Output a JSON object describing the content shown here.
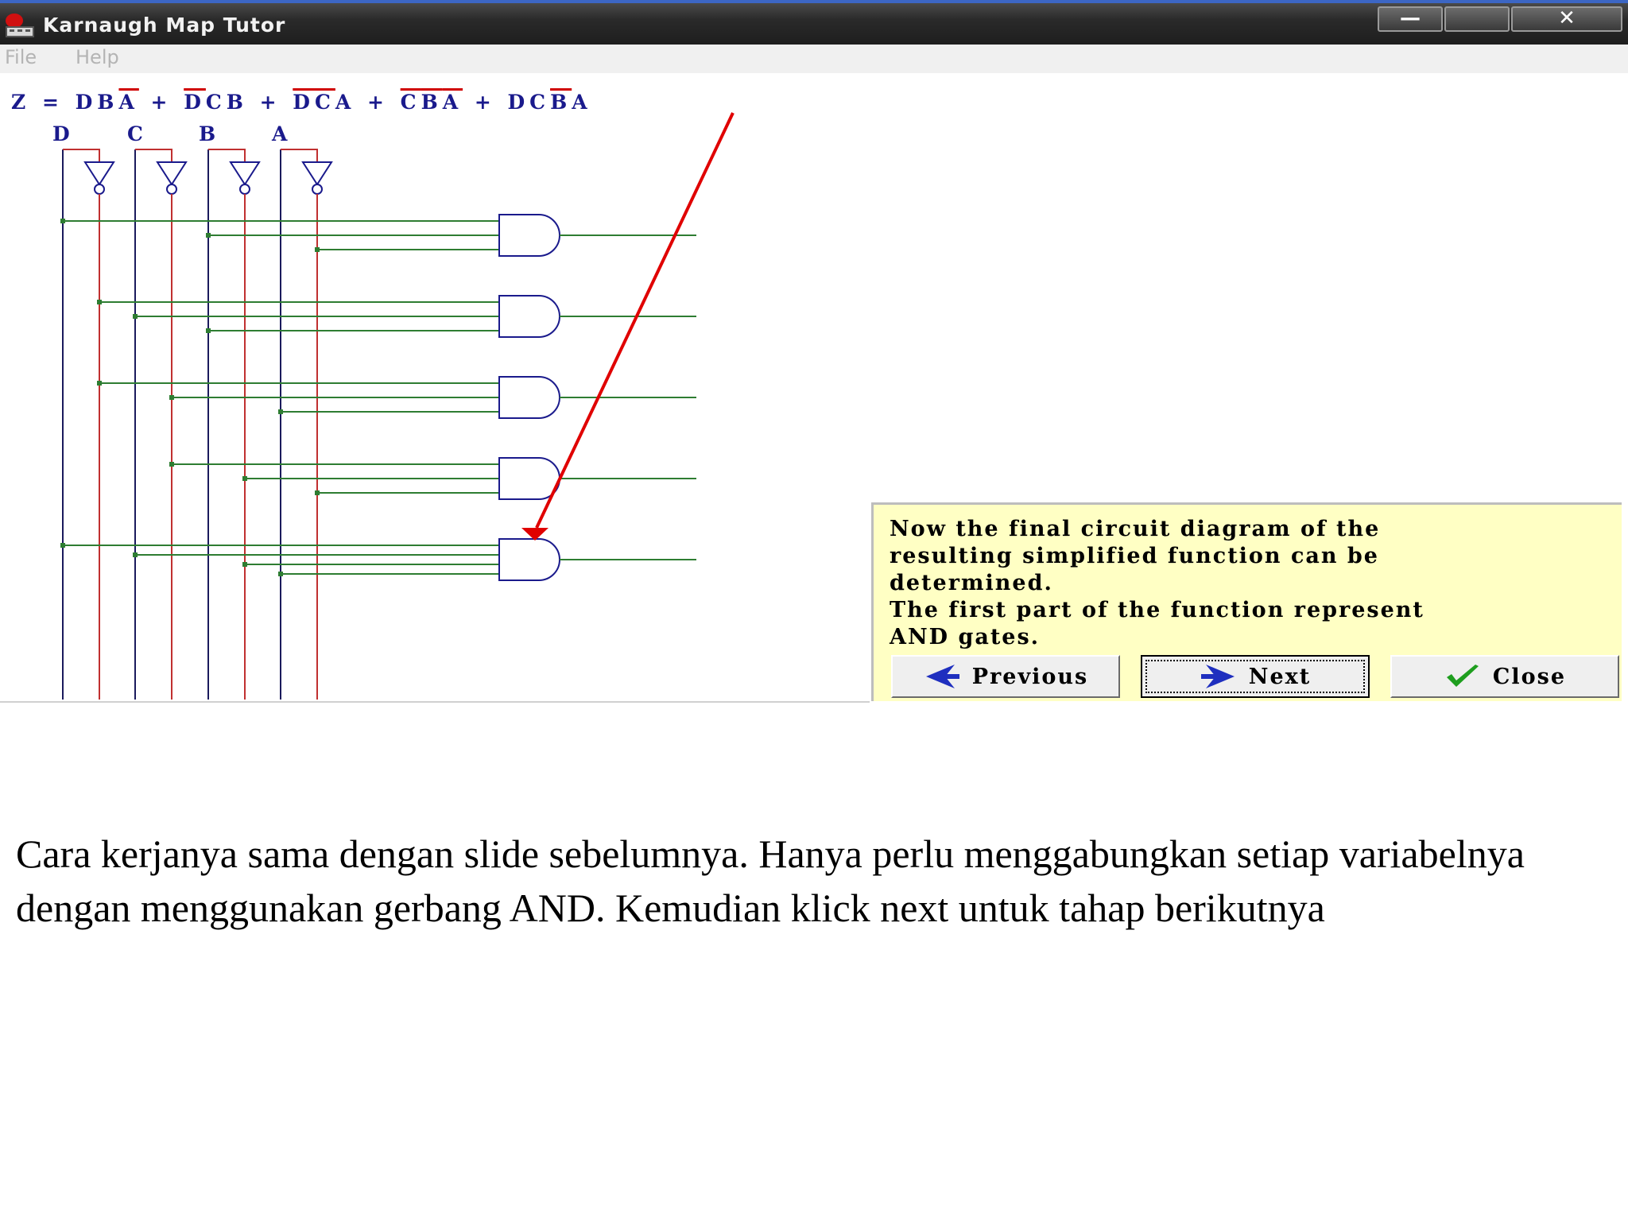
{
  "window": {
    "title": "Karnaugh Map Tutor",
    "minimize_symbol": "—",
    "maximize_symbol": "",
    "close_symbol": "✕"
  },
  "menu": {
    "items": [
      "File",
      "Help"
    ]
  },
  "circuit": {
    "equation_prefix": "Z = ",
    "terms": [
      {
        "parts": [
          {
            "v": "D",
            "neg": false
          },
          {
            "v": "B",
            "neg": false
          },
          {
            "v": "A",
            "neg": true
          }
        ]
      },
      {
        "parts": [
          {
            "v": "D",
            "neg": true
          },
          {
            "v": "C",
            "neg": false
          },
          {
            "v": "B",
            "neg": false
          }
        ]
      },
      {
        "parts": [
          {
            "v": "D",
            "neg": true
          },
          {
            "v": "C",
            "neg": true
          },
          {
            "v": "A",
            "neg": false
          }
        ]
      },
      {
        "parts": [
          {
            "v": "C",
            "neg": true
          },
          {
            "v": "B",
            "neg": true
          },
          {
            "v": "A",
            "neg": true
          }
        ]
      },
      {
        "parts": [
          {
            "v": "D",
            "neg": false
          },
          {
            "v": "C",
            "neg": false
          },
          {
            "v": "B",
            "neg": true
          },
          {
            "v": "A",
            "neg": false
          }
        ]
      }
    ],
    "variables": [
      "D",
      "C",
      "B",
      "A"
    ],
    "colors": {
      "true_wire": "#1a1a5c",
      "inverted_wire": "#c03030",
      "and_input_wire": "#2e7d32",
      "gate": "#1a1a8c",
      "arrow": "#e00000"
    }
  },
  "panel": {
    "message": "Now the final circuit diagram of the\nresulting simplified function can be\ndetermined.\nThe first part of the function represent\nAND gates.",
    "buttons": {
      "previous": {
        "label": "Previous",
        "icon": "left-arrow-icon"
      },
      "next": {
        "label": "Next",
        "icon": "right-arrow-icon"
      },
      "close": {
        "label": "Close",
        "icon": "checkmark-icon"
      }
    }
  },
  "caption": "Cara kerjanya sama dengan slide sebelumnya. Hanya perlu menggabungkan setiap variabelnya dengan menggunakan gerbang AND. Kemudian klick next untuk tahap berikutnya"
}
